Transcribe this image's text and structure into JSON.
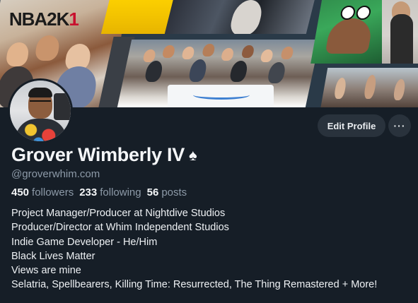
{
  "profile": {
    "display_name": "Grover Wimberly IV",
    "name_badge_icon": "spade-icon",
    "handle": "@groverwhim.com",
    "stats": {
      "followers_count": "450",
      "followers_label": "followers",
      "following_count": "233",
      "following_label": "following",
      "posts_count": "56",
      "posts_label": "posts"
    },
    "bio_lines": [
      "Project Manager/Producer at Nightdive Studios",
      "Producer/Director at Whim Independent Studios",
      "Indie Game Developer - He/Him",
      "Black Lives Matter",
      "Views are mine",
      "Selatria, Spellbearers, Killing Time: Resurrected, The Thing Remastered + More!"
    ]
  },
  "actions": {
    "edit_profile_label": "Edit Profile",
    "more_label": "···"
  },
  "banner": {
    "nba_text_dark": "NBA2K",
    "nba_text_red": "1"
  },
  "colors": {
    "background": "#161e27",
    "button_bg": "#29323c",
    "muted_text": "#8d9aa8",
    "primary_text": "#f4f6f8"
  }
}
